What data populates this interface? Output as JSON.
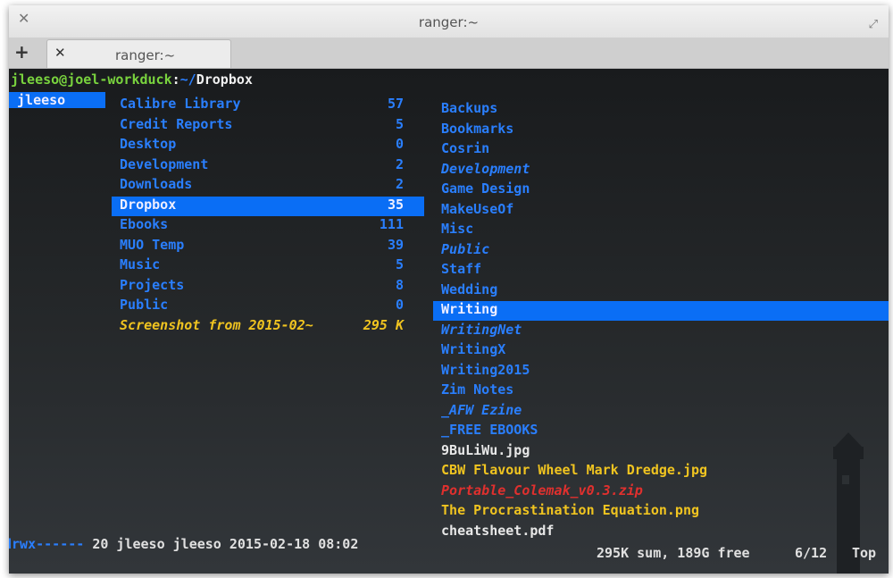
{
  "window": {
    "title": "ranger:~",
    "tab_label": "ranger:~",
    "close_glyph": "✕",
    "add_glyph": "+",
    "max_glyph": "⤢"
  },
  "prompt": {
    "user_host": "jleeso@joel-workduck",
    "sep": ":",
    "path_prefix": "~/",
    "current": "Dropbox"
  },
  "col1": {
    "items": [
      "jleeso"
    ]
  },
  "col2": {
    "items": [
      {
        "name": "Calibre Library",
        "count": "57"
      },
      {
        "name": "Credit Reports",
        "count": "5"
      },
      {
        "name": "Desktop",
        "count": "0"
      },
      {
        "name": "Development",
        "count": "2"
      },
      {
        "name": "Downloads",
        "count": "2"
      },
      {
        "name": "Dropbox",
        "count": "35"
      },
      {
        "name": "Ebooks",
        "count": "111"
      },
      {
        "name": "MUO Temp",
        "count": "39"
      },
      {
        "name": "Music",
        "count": "5"
      },
      {
        "name": "Projects",
        "count": "8"
      },
      {
        "name": "Public",
        "count": "0"
      },
      {
        "name": "Screenshot from 2015-02~",
        "count": "295 K"
      }
    ]
  },
  "col3": {
    "items": [
      "Backups",
      "Bookmarks",
      "Cosrin",
      "Development",
      "Game Design",
      "MakeUseOf",
      "Misc",
      "Public",
      "Staff",
      "Wedding",
      "Writing",
      "WritingNet",
      "WritingX",
      "Writing2015",
      "Zim Notes",
      "_AFW Ezine",
      "_FREE EBOOKS",
      "9BuLiWu.jpg",
      "CBW Flavour Wheel Mark Dredge.jpg",
      "Portable_Colemak_v0.3.zip",
      "The Procrastination Equation.png",
      "cheatsheet.pdf"
    ]
  },
  "status": {
    "perms": "drwx------",
    "info": "20 jleeso jleeso 2015-02-18 08:02",
    "summary": "295K sum, 189G free",
    "position": "6/12",
    "scroll": "Top"
  }
}
